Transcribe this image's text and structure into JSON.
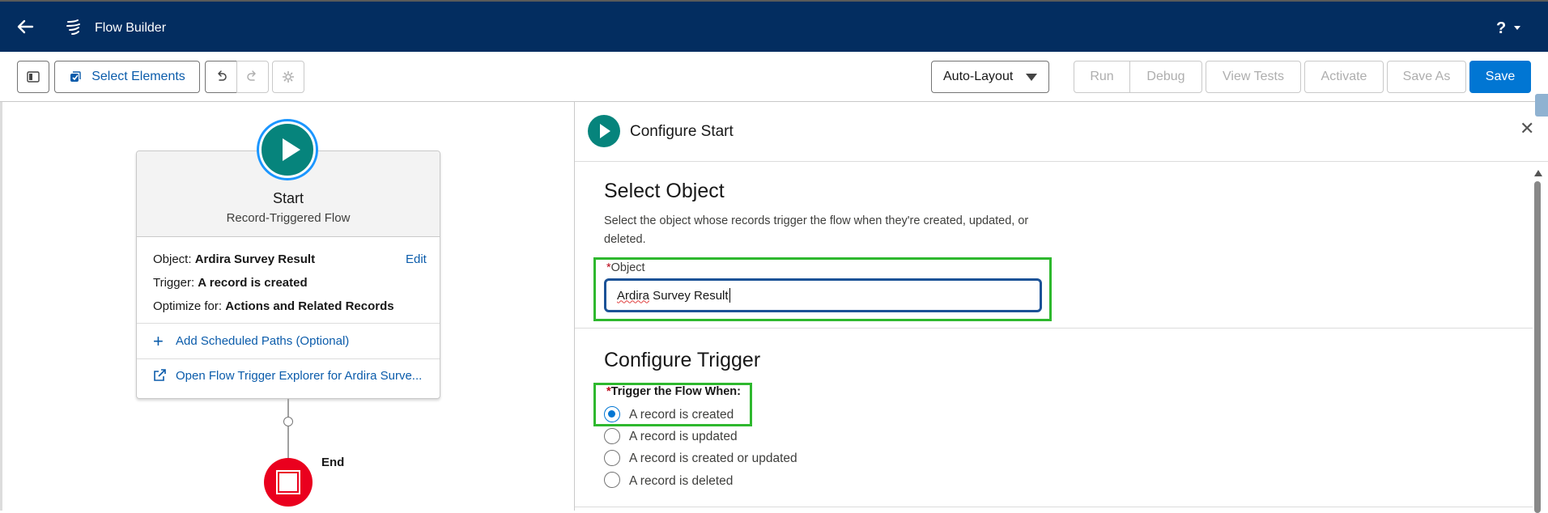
{
  "app": {
    "title": "Flow Builder",
    "help_label": "?"
  },
  "toolbar": {
    "select_elements": "Select Elements",
    "layout_mode": "Auto-Layout",
    "run": "Run",
    "debug": "Debug",
    "view_tests": "View Tests",
    "activate": "Activate",
    "save_as": "Save As",
    "save": "Save"
  },
  "canvas": {
    "start_title": "Start",
    "start_subtitle": "Record-Triggered Flow",
    "object_label": "Object:",
    "object_value": "Ardira Survey Result",
    "edit": "Edit",
    "trigger_label": "Trigger:",
    "trigger_value": "A record is created",
    "optimize_label": "Optimize for:",
    "optimize_value": "Actions and Related Records",
    "add_scheduled": "Add Scheduled Paths (Optional)",
    "open_explorer": "Open Flow Trigger Explorer for Ardira Surve...",
    "end_label": "End"
  },
  "panel": {
    "title": "Configure Start",
    "select_object_heading": "Select Object",
    "select_object_desc": "Select the object whose records trigger the flow when they're created, updated, or deleted.",
    "object_field_label": "Object",
    "object_field_value_word1": "Ardira",
    "object_field_value_rest": " Survey Result",
    "configure_trigger_heading": "Configure Trigger",
    "trigger_when_label": "Trigger the Flow When:",
    "options": [
      {
        "label": "A record is created",
        "selected": true
      },
      {
        "label": "A record is updated",
        "selected": false
      },
      {
        "label": "A record is created or updated",
        "selected": false
      },
      {
        "label": "A record is deleted",
        "selected": false
      }
    ]
  },
  "colors": {
    "header": "#032d60",
    "brand": "#0176d3",
    "start_node": "#06847c",
    "end_node": "#ea001e",
    "highlight": "#2eb82e"
  }
}
